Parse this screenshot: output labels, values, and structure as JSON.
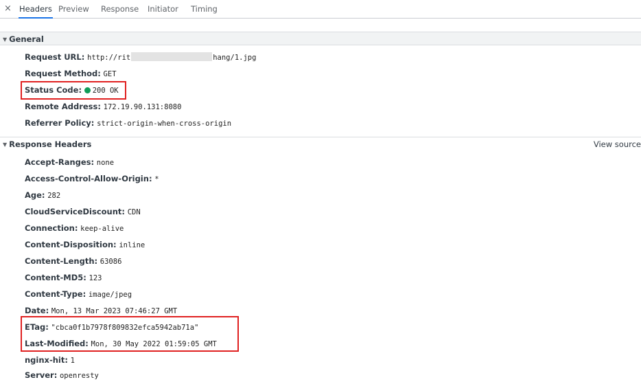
{
  "tabs": {
    "close": "×",
    "items": [
      {
        "id": "headers",
        "label": "Headers",
        "active": true
      },
      {
        "id": "preview",
        "label": "Preview",
        "active": false
      },
      {
        "id": "response",
        "label": "Response",
        "active": false
      },
      {
        "id": "initiator",
        "label": "Initiator",
        "active": false
      },
      {
        "id": "timing",
        "label": "Timing",
        "active": false
      }
    ]
  },
  "general": {
    "title": "General",
    "request_url": {
      "name": "Request URL:",
      "value_start": "http://rit",
      "value_end": "hang/1.jpg"
    },
    "request_method": {
      "name": "Request Method:",
      "value": "GET"
    },
    "status_code": {
      "name": "Status Code:",
      "value": "200 OK",
      "status_color": "#0f9d58"
    },
    "remote_address": {
      "name": "Remote Address:",
      "value": "172.19.90.131:8080"
    },
    "referrer_policy": {
      "name": "Referrer Policy:",
      "value": "strict-origin-when-cross-origin"
    }
  },
  "response_headers": {
    "title": "Response Headers",
    "view_source": "View source",
    "items": [
      {
        "name": "Accept-Ranges:",
        "value": "none"
      },
      {
        "name": "Access-Control-Allow-Origin:",
        "value": "*"
      },
      {
        "name": "Age:",
        "value": "282"
      },
      {
        "name": "CloudServiceDiscount:",
        "value": "CDN"
      },
      {
        "name": "Connection:",
        "value": "keep-alive"
      },
      {
        "name": "Content-Disposition:",
        "value": "inline"
      },
      {
        "name": "Content-Length:",
        "value": "63086"
      },
      {
        "name": "Content-MD5:",
        "value": "123"
      },
      {
        "name": "Content-Type:",
        "value": "image/jpeg"
      },
      {
        "name": "Date:",
        "value": "Mon, 13 Mar 2023 07:46:27 GMT"
      },
      {
        "name": "ETag:",
        "value": "\"cbca0f1b7978f809832efca5942ab71a\""
      },
      {
        "name": "Last-Modified:",
        "value": "Mon, 30 May 2022 01:59:05 GMT"
      },
      {
        "name": "nginx-hit:",
        "value": "1"
      },
      {
        "name": "Server:",
        "value": "openresty"
      }
    ]
  },
  "colors": {
    "highlight_box": "#e02020",
    "active_tab": "#1a73e8"
  }
}
